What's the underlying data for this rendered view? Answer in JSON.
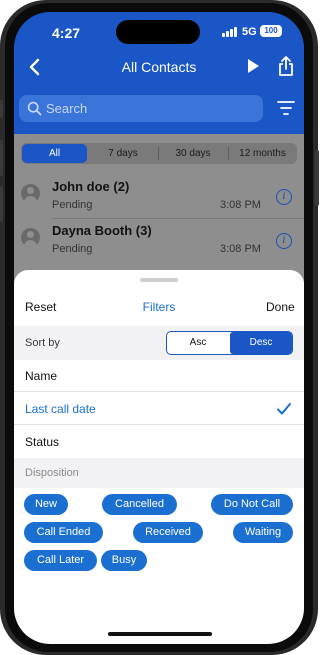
{
  "status_bar": {
    "time": "4:27",
    "network": "5G",
    "battery": "100"
  },
  "nav": {
    "title": "All Contacts",
    "back_icon": "chevron-left-icon",
    "play_icon": "play-icon",
    "share_icon": "share-icon"
  },
  "search": {
    "placeholder": "Search",
    "icon": "search-icon",
    "filter_icon": "filter-icon"
  },
  "date_segments": [
    {
      "label": "All",
      "selected": true
    },
    {
      "label": "7 days",
      "selected": false
    },
    {
      "label": "30 days",
      "selected": false
    },
    {
      "label": "12 months",
      "selected": false
    }
  ],
  "contacts": [
    {
      "name": "John doe (2)",
      "status": "Pending",
      "time": "3:08 PM"
    },
    {
      "name": "Dayna Booth (3)",
      "status": "Pending",
      "time": "3:08 PM"
    }
  ],
  "sheet": {
    "reset_label": "Reset",
    "title": "Filters",
    "done_label": "Done",
    "sort_by_label": "Sort by",
    "sort_options": [
      {
        "label": "Asc",
        "selected": false
      },
      {
        "label": "Desc",
        "selected": true
      }
    ],
    "sort_fields": [
      {
        "label": "Name",
        "selected": false
      },
      {
        "label": "Last call date",
        "selected": true
      },
      {
        "label": "Status",
        "selected": false
      }
    ],
    "disposition_label": "Disposition",
    "dispositions": [
      "New",
      "Cancelled",
      "Do Not Call",
      "Call Ended",
      "Received",
      "Waiting",
      "Call Later",
      "Busy"
    ]
  },
  "colors": {
    "brand_blue": "#1a56c6",
    "accent_blue": "#1a6fd0"
  }
}
